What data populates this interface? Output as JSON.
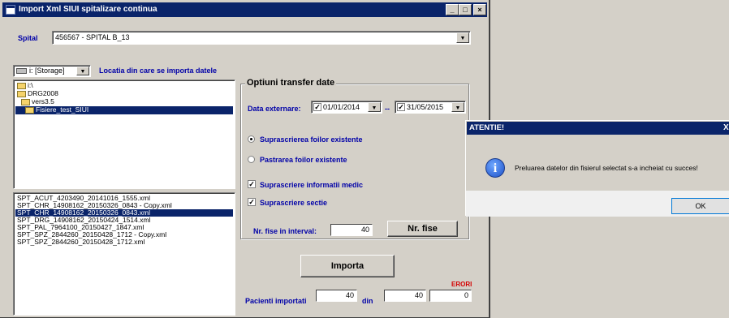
{
  "window": {
    "title": "Import Xml SIUI spitalizare continua",
    "min_label": "_",
    "max_label": "□",
    "close_label": "×"
  },
  "spital": {
    "label": "Spital",
    "value": "456567 - SPITAL B_13"
  },
  "drive": {
    "value": "i: [Storage]",
    "caption": "Locatia din care se importa datele"
  },
  "folders": [
    {
      "label": "i:\\",
      "selected": false
    },
    {
      "label": "DRG2008",
      "selected": false
    },
    {
      "label": "vers3.5",
      "selected": false
    },
    {
      "label": "Fisiere_test_SIUI",
      "selected": true
    }
  ],
  "files": [
    {
      "label": "SPT_ACUT_4203490_20141016_1555.xml",
      "selected": false
    },
    {
      "label": "SPT_CHR_14908162_20150326_0843 - Copy.xml",
      "selected": false
    },
    {
      "label": "SPT_CHR_14908162_20150326_0843.xml",
      "selected": true
    },
    {
      "label": "SPT_DRG_14908162_20150424_1514.xml",
      "selected": false
    },
    {
      "label": "SPT_PAL_7964100_20150427_1847.xml",
      "selected": false
    },
    {
      "label": "SPT_SPZ_2844260_20150428_1712 - Copy.xml",
      "selected": false
    },
    {
      "label": "SPT_SPZ_2844260_20150428_1712.xml",
      "selected": false
    }
  ],
  "options": {
    "group_title": "Optiuni transfer date",
    "data_externare_label": "Data externare:",
    "date_from": "01/01/2014",
    "date_sep": "--",
    "date_to": "31/05/2015",
    "radio_overwrite": "Suprascrierea foilor existente",
    "radio_keep": "Pastrarea foilor existente",
    "check_medic": "Suprascriere informatii medic",
    "check_sectie": "Suprascriere sectie",
    "nr_fise_label": "Nr. fise in interval:",
    "nr_fise_value": "40",
    "nr_fise_button": "Nr. fise"
  },
  "import_button": "Importa",
  "erori_label": "ERORI",
  "pacienti": {
    "label": "Pacienti importati",
    "imported": "40",
    "din_label": "din",
    "total": "40",
    "errors": "0"
  },
  "dialog": {
    "title": "ATENTIE!",
    "close_label": "X",
    "message": "Preluarea datelor din fisierul selectat s-a incheiat cu succes!",
    "ok_label": "OK"
  }
}
